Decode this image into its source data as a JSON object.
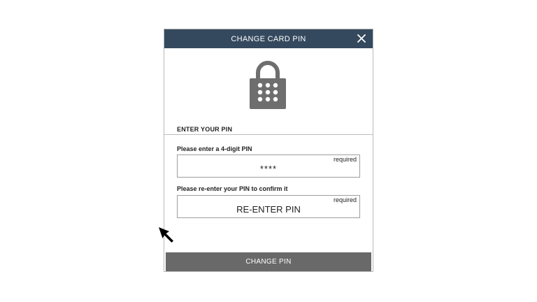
{
  "dialog": {
    "title": "CHANGE CARD PIN",
    "close_icon": "close-icon",
    "lock_icon": "padlock-keypad-icon",
    "section_title": "ENTER YOUR PIN",
    "fields": [
      {
        "label": "Please enter a 4-digit PIN",
        "value": "****",
        "placeholder": "",
        "required_text": "required"
      },
      {
        "label": "Please re-enter your PIN to confirm it",
        "value": "",
        "placeholder": "RE-ENTER PIN",
        "required_text": "required"
      }
    ],
    "submit_label": "CHANGE PIN"
  },
  "colors": {
    "header_bg": "#35495e",
    "button_bg": "#696969",
    "icon_gray": "#6e6e6e"
  }
}
